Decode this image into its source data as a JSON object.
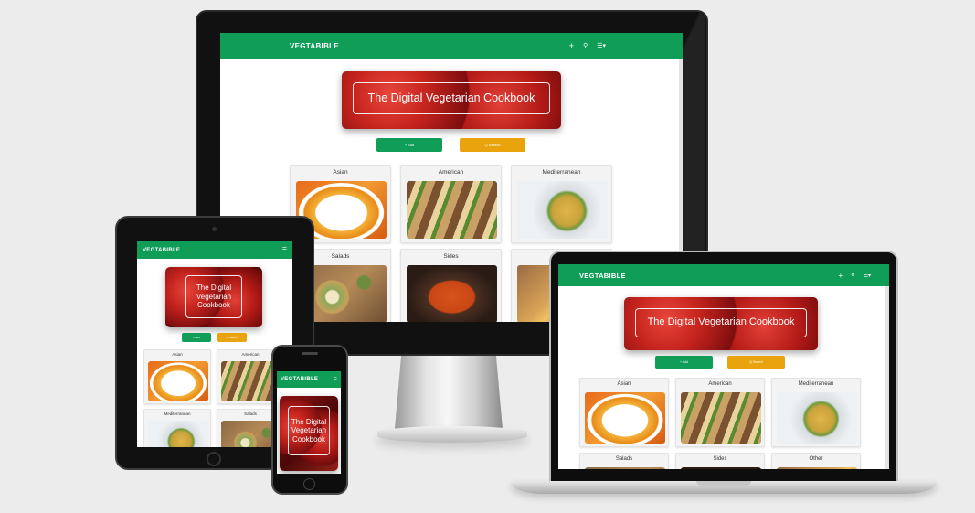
{
  "site": {
    "brand": "VEGTABIBLE",
    "hero_title": "The Digital Vegetarian Cookbook",
    "add_label": "+ Add",
    "search_label": "Q Search",
    "colors": {
      "nav": "#0f9d58",
      "add_button": "#0f9d58",
      "search_button": "#e9a30c"
    },
    "icons": {
      "add": "plus-icon",
      "search": "search-icon",
      "menu": "menu-icon",
      "hamburger": "hamburger-icon"
    },
    "categories": [
      {
        "name": "Asian",
        "image": "noodle-bowl"
      },
      {
        "name": "American",
        "image": "tacos"
      },
      {
        "name": "Mediterranean",
        "image": "pasta-salad"
      },
      {
        "name": "Salads",
        "image": "salad-table"
      },
      {
        "name": "Sides",
        "image": "sweet-potato-fries"
      },
      {
        "name": "Other",
        "image": "baked-dish"
      }
    ]
  }
}
